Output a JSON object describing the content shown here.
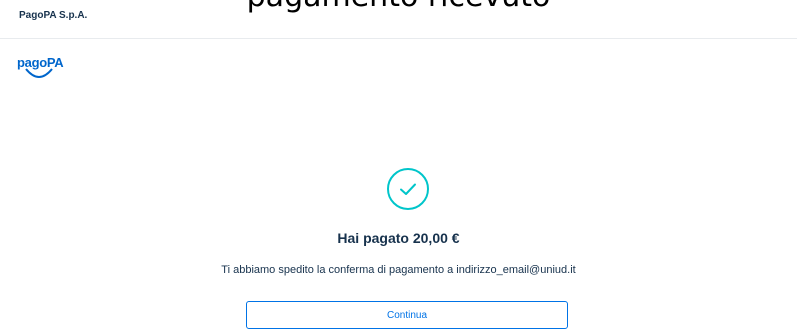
{
  "overlay": {
    "text": "pagamento ricevuto"
  },
  "header": {
    "company": "PagoPA S.p.A."
  },
  "logo": {
    "text": "pagoPA"
  },
  "result": {
    "title": "Hai pagato 20,00 €",
    "message": "Ti abbiamo spedito la conferma di pagamento a indirizzo_email@uniud.it",
    "continue_label": "Continua"
  },
  "icons": {
    "status": "check-circle-icon"
  },
  "colors": {
    "accent": "#00c5ca",
    "primary": "#0073e6",
    "text": "#17324d"
  }
}
